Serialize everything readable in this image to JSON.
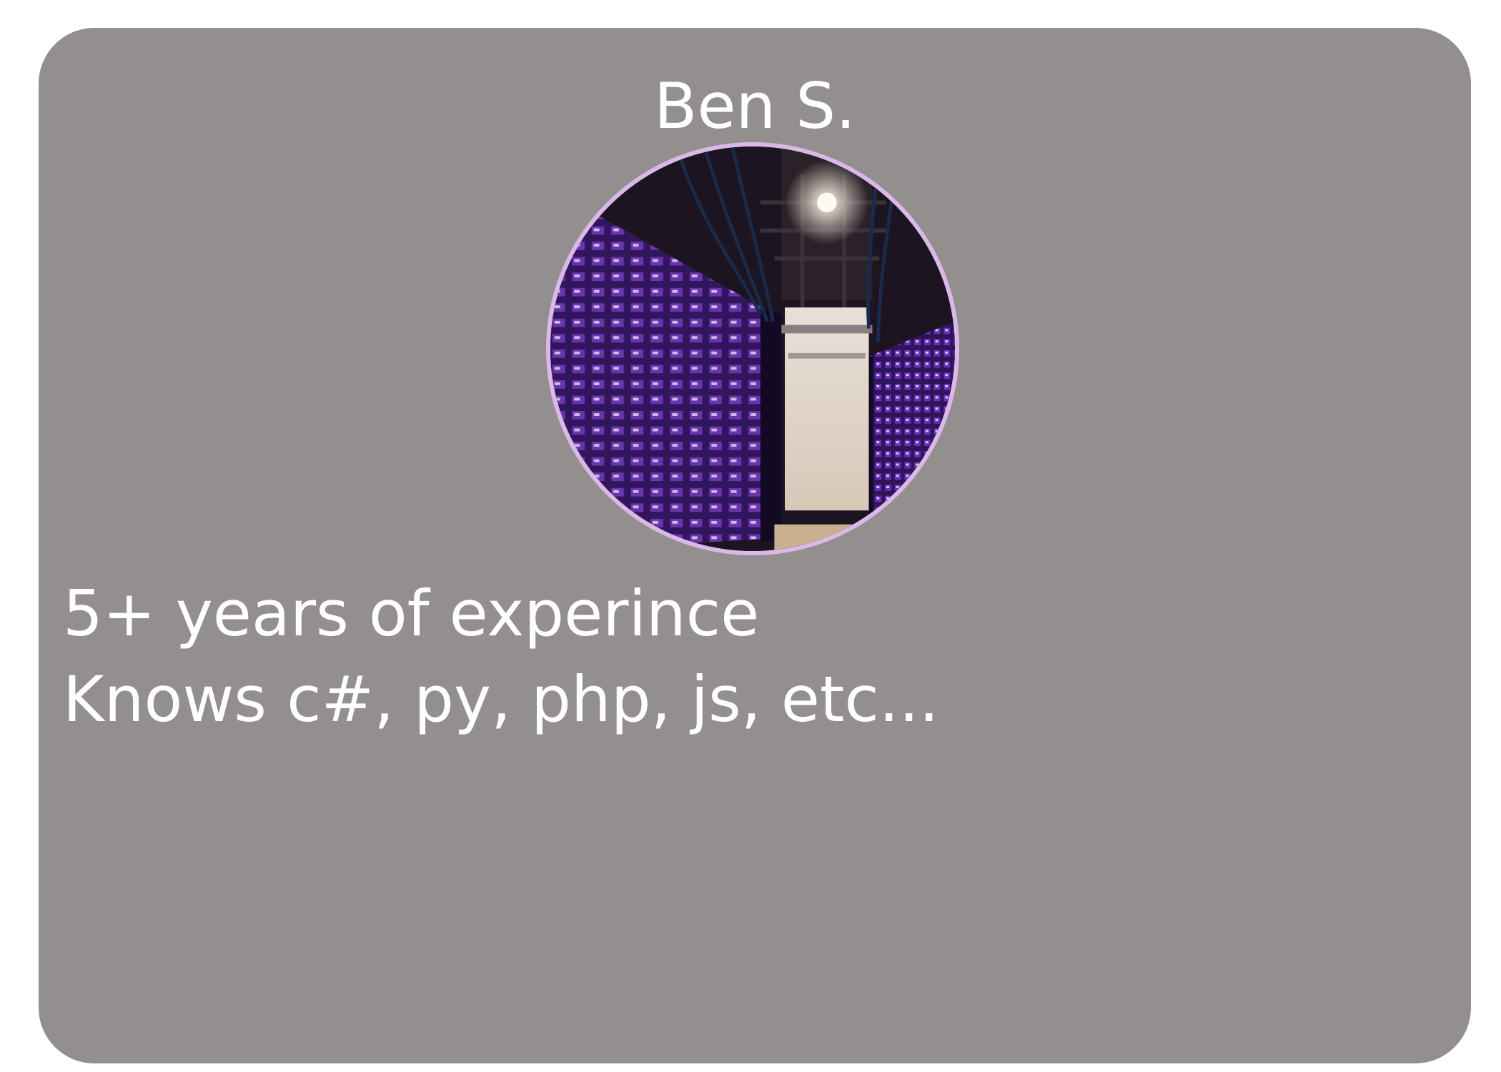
{
  "card": {
    "name": "Ben S.",
    "avatar_icon": "server-room-photo",
    "details": {
      "experience": "5+ years of experince",
      "skills": "Knows c#, py, php, js, etc..."
    }
  },
  "colors": {
    "card_background": "#948f8f",
    "avatar_border": "#dcb8e8",
    "text": "#ffffff"
  }
}
